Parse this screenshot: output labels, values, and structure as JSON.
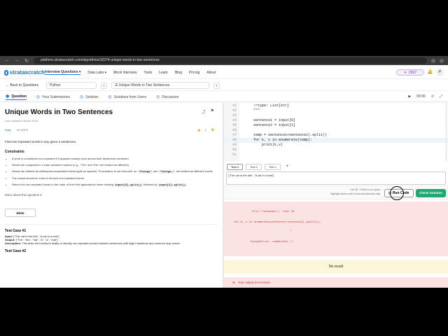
{
  "browser": {
    "url": "platform.stratascratch.com/algorithms/10374-unique-words-in-two-sentences"
  },
  "header": {
    "logo": "stratascratch",
    "nav": [
      "Interview Questions ▾",
      "Data Labs ▾",
      "Mock Interview",
      "Tools",
      "Learn",
      "Blog",
      "Pricing",
      "About"
    ],
    "streak": "2907",
    "avatar": "P"
  },
  "toolbar": {
    "back": "Back to Questions",
    "language": "Python",
    "prev": "‹",
    "next": "›",
    "question_title": "Unique Words in Two Sentences"
  },
  "tabs": {
    "items": [
      "Question",
      "Your Submissions",
      "Solution",
      "Solutions from Users",
      "Discussion"
    ],
    "timer": "00:00"
  },
  "question": {
    "title": "Unique Words in Two Sentences",
    "updated": "Last Updated: March 2024",
    "difficulty": "Easy",
    "id": "ID 10374",
    "likes": "1",
    "description": "Find non-repeated words in any given 2 sentences.",
    "constraints_heading": "Constraints",
    "constraints": [
      "A word is considered non-repeated if it appears exactly once across both sentences combined.",
      "Words are compared in a case-sensitive manner (e.g., \"The\" and \"the\" are treated as different).",
      "The output should be a list of all such non-repeated words."
    ],
    "constraint_punct": {
      "pre": "Words are defined as whitespace-separated tokens (split on spaces). Punctuation is not removed, so",
      "code1": "\"things\"",
      "mid": "and",
      "code2": "\"things,\"",
      "post": "are treated as different words."
    },
    "constraint_order": {
      "pre": "Return the non-repeated words in the order of their first appearance when reading",
      "code1": "input[0].split()",
      "mid": "followed by",
      "code2": "input[1].split()"
    },
    "more": "More about this question ▾",
    "hints": "Hints",
    "tc1": {
      "heading": "Test Case #1",
      "input_label": "Input:",
      "input": "[\"The cat in the hat\", \"A cat in a mat\"]",
      "output_label": "Output:",
      "output": "[\"The\", \"the\", \"hat\", \"A\", \"a\", \"mat\"]",
      "desc_label": "Description:",
      "desc": "This tests the function's ability to identify non-repeated words between sentences with slight variations and common stop words."
    },
    "tc2_heading": "Test Case #2"
  },
  "editor": {
    "lines": [
      {
        "n": "41",
        "code": "    :rtype: List[str]"
      },
      {
        "n": "42",
        "code": "    \"\"\""
      },
      {
        "n": "43",
        "code": ""
      },
      {
        "n": "44",
        "code": "    sentence1 = input[0]"
      },
      {
        "n": "45",
        "code": "    sentence2 = input[1]"
      },
      {
        "n": "46",
        "code": ""
      },
      {
        "n": "47",
        "code": "    temp = sentence1+sentence2).split()"
      },
      {
        "n": "48",
        "code": "    for k, v in enumerate(temp):"
      },
      {
        "n": "49",
        "code": "        print(k,v)"
      },
      {
        "n": "50",
        "code": ""
      },
      {
        "n": "51",
        "code": ""
      }
    ]
  },
  "tests": {
    "tabs": [
      "Test 1",
      "Test 2",
      "Test 3"
    ],
    "add": "+",
    "input_value": "[\"The cat in the hat\", \"A cat in a mat\"]"
  },
  "run": {
    "hint1": "Use ⌘ + Enter to run query",
    "hint2": "Highlight some code to execute selection only",
    "run_label": "Run Code",
    "check_label": "Check Solution"
  },
  "error": {
    "l1": "File \"<unknown>\", line 76",
    "l2": "for k, v in enumerate(sentence1+sentence2).split()):",
    "l3": "^",
    "l4": "SyntaxError: unmatched ')'"
  },
  "result": {
    "none": "No result",
    "incorrect": "Your output is incorrect."
  }
}
